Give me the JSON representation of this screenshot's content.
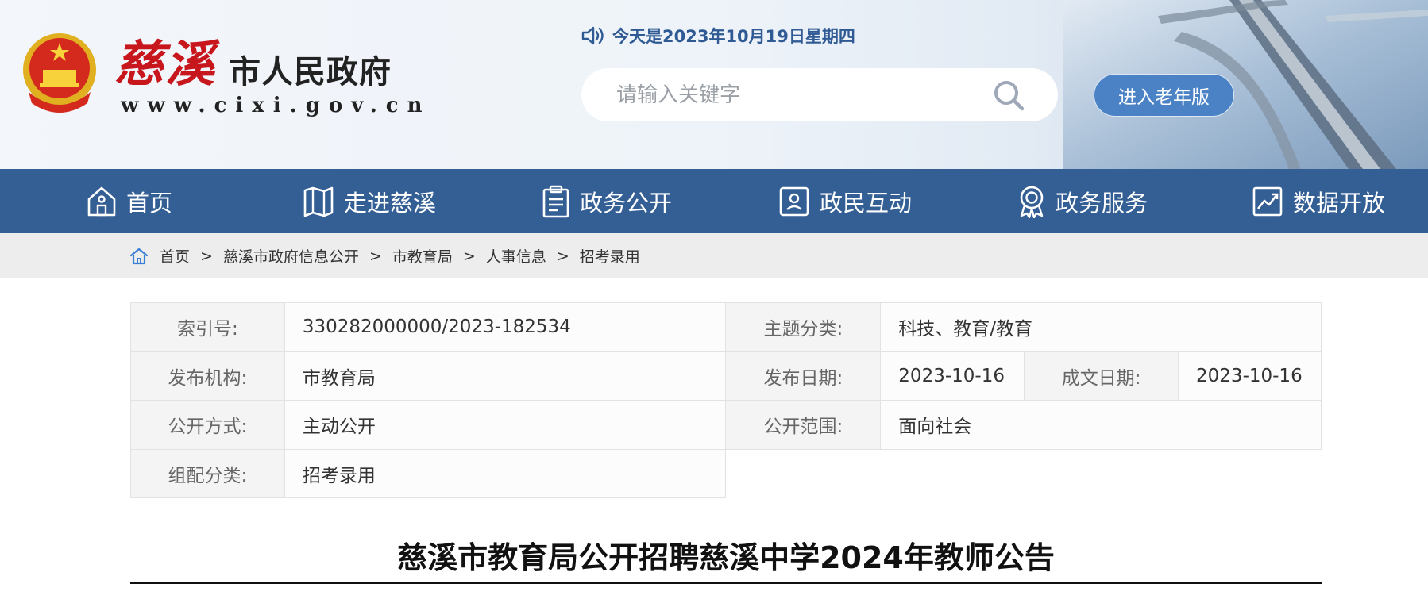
{
  "header": {
    "logo_cixi": "慈溪",
    "logo_gov": "市人民政府",
    "logo_url": "www.cixi.gov.cn",
    "date_text": "今天是2023年10月19日星期四",
    "search_placeholder": "请输入关键字",
    "elder_button": "进入老年版"
  },
  "nav": {
    "items": [
      {
        "label": "首页",
        "icon": "home-icon"
      },
      {
        "label": "走进慈溪",
        "icon": "map-icon"
      },
      {
        "label": "政务公开",
        "icon": "clipboard-icon"
      },
      {
        "label": "政民互动",
        "icon": "user-card-icon"
      },
      {
        "label": "政务服务",
        "icon": "badge-icon"
      },
      {
        "label": "数据开放",
        "icon": "chart-icon"
      }
    ]
  },
  "breadcrumb": {
    "items": [
      "首页",
      "慈溪市政府信息公开",
      "市教育局",
      "人事信息",
      "招考录用"
    ],
    "separator": ">"
  },
  "meta": {
    "index_label": "索引号:",
    "index_value": "330282000000/2023-182534",
    "topic_label": "主题分类:",
    "topic_value": "科技、教育/教育",
    "org_label": "发布机构:",
    "org_value": "市教育局",
    "pubdate_label": "发布日期:",
    "pubdate_value": "2023-10-16",
    "created_label": "成文日期:",
    "created_value": "2023-10-16",
    "mode_label": "公开方式:",
    "mode_value": "主动公开",
    "scope_label": "公开范围:",
    "scope_value": "面向社会",
    "category_label": "组配分类:",
    "category_value": "招考录用"
  },
  "document": {
    "title": "慈溪市教育局公开招聘慈溪中学2024年教师公告"
  },
  "colors": {
    "nav_bg": "#345f95",
    "accent_red": "#c8161d",
    "elder_button_bg": "#4a82c5",
    "date_text": "#2f5a94"
  }
}
